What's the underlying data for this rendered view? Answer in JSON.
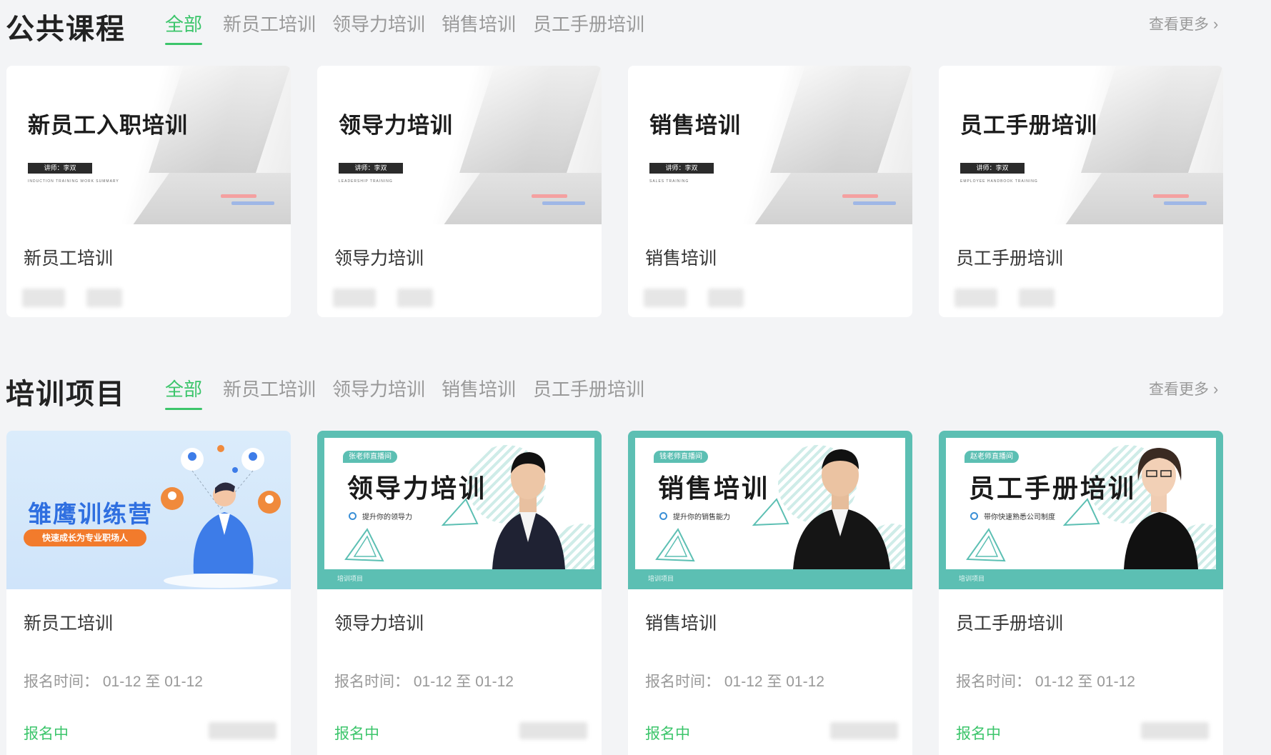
{
  "public_courses": {
    "title": "公共课程",
    "tabs": [
      "全部",
      "新员工培训",
      "领导力培训",
      "销售培训",
      "员工手册培训"
    ],
    "more": "查看更多",
    "cards": [
      {
        "thumb_title": "新员工入职培训",
        "thumb_tag": "讲师：李双",
        "thumb_sub": "INDUCTION TRAINING WORK SUMMARY",
        "title": "新员工培训"
      },
      {
        "thumb_title": "领导力培训",
        "thumb_tag": "讲师：李双",
        "thumb_sub": "LEADERSHIP TRAINING",
        "title": "领导力培训"
      },
      {
        "thumb_title": "销售培训",
        "thumb_tag": "讲师：李双",
        "thumb_sub": "SALES TRAINING",
        "title": "销售培训"
      },
      {
        "thumb_title": "员工手册培训",
        "thumb_tag": "讲师：李双",
        "thumb_sub": "EMPLOYEE HANDBOOK TRAINING",
        "title": "员工手册培训"
      }
    ]
  },
  "training_projects": {
    "title": "培训项目",
    "tabs": [
      "全部",
      "新员工培训",
      "领导力培训",
      "销售培训",
      "员工手册培训"
    ],
    "more": "查看更多",
    "cards": [
      {
        "thumb_title": "雏鹰训练营",
        "thumb_pill": "快速成长为专业职场人",
        "title": "新员工培训",
        "reg_label": "报名时间：",
        "reg_range": "01-12 至 01-12",
        "status": "报名中"
      },
      {
        "thumb_badge": "张老师直播间",
        "thumb_title": "领导力培训",
        "thumb_sub": "提升你的领导力",
        "thumb_foot": "培训项目",
        "title": "领导力培训",
        "reg_label": "报名时间：",
        "reg_range": "01-12 至 01-12",
        "status": "报名中"
      },
      {
        "thumb_badge": "钱老师直播间",
        "thumb_title": "销售培训",
        "thumb_sub": "提升你的销售能力",
        "thumb_foot": "培训项目",
        "title": "销售培训",
        "reg_label": "报名时间：",
        "reg_range": "01-12 至 01-12",
        "status": "报名中"
      },
      {
        "thumb_badge": "赵老师直播间",
        "thumb_title": "员工手册培训",
        "thumb_sub": "带你快速熟悉公司制度",
        "thumb_foot": "培训项目",
        "title": "员工手册培训",
        "reg_label": "报名时间：",
        "reg_range": "01-12 至 01-12",
        "status": "报名中"
      }
    ]
  },
  "colors": {
    "accent": "#3cc56b",
    "teal": "#5cbfb3",
    "background": "#f3f4f6"
  },
  "icons": [
    "chevron-right-icon",
    "radio-dot-icon"
  ]
}
